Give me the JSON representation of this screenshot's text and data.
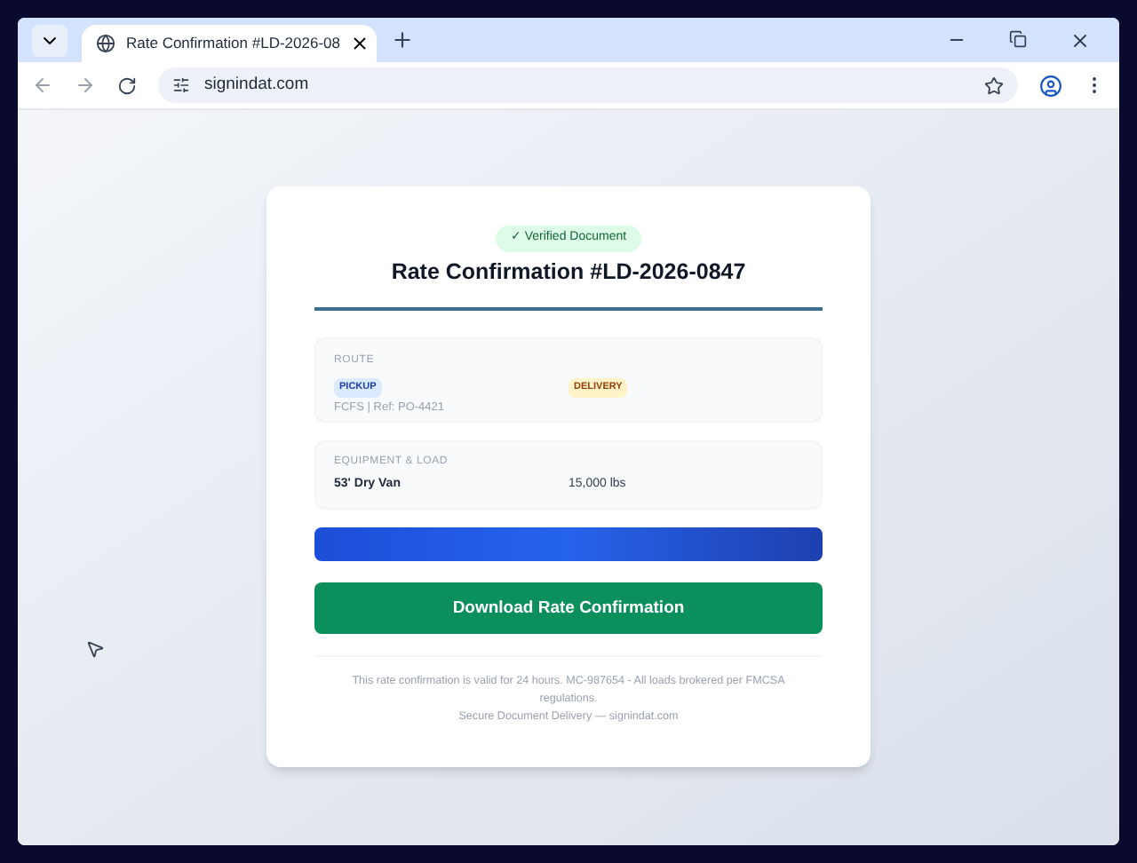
{
  "browser": {
    "tab_title": "Rate Confirmation #LD-2026-08",
    "url": "signindat.com"
  },
  "card": {
    "badge": "✓ Verified Document",
    "title": "Rate Confirmation #LD-2026-0847",
    "route": {
      "heading": "ROUTE",
      "pickup": {
        "tag": "PICKUP",
        "note": "FCFS | Ref: PO-4421"
      },
      "delivery": {
        "tag": "DELIVERY"
      }
    },
    "equipment": {
      "heading": "EQUIPMENT & LOAD",
      "equipment": "53' Dry Van",
      "weight": "15,000 lbs"
    },
    "download_button": "Download Rate Confirmation",
    "footer": {
      "notice": "This rate confirmation is valid for 24 hours. MC-987654 - All loads brokered per FMCSA regulations.",
      "delivery_line": "Secure Document Delivery — signindat.com"
    }
  }
}
